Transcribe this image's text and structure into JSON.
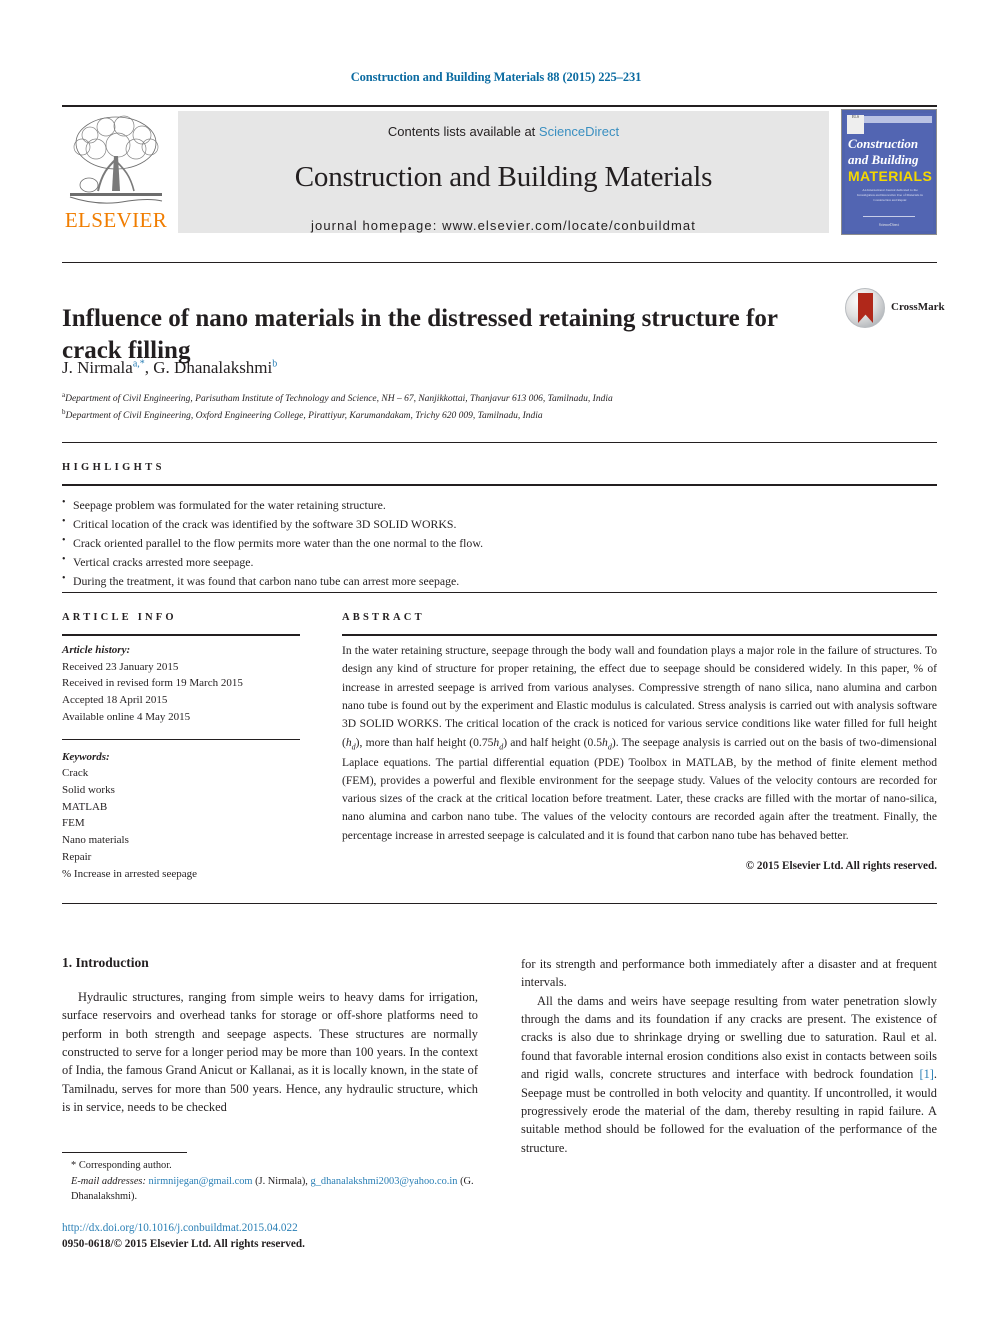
{
  "running_head": "Construction and Building Materials 88 (2015) 225–231",
  "masthead": {
    "publisher_name": "ELSEVIER",
    "contents_prefix": "Contents lists available at ",
    "sciencedirect": "ScienceDirect",
    "journal_title": "Construction and Building Materials",
    "homepage": "journal homepage: www.elsevier.com/locate/conbuildmat",
    "cover": {
      "line1": "Construction",
      "line2": "and Building",
      "line3": "MATERIALS",
      "blurb": "An International Journal dedicated to the Investigation and Innovative Use of Materials in Construction and Repair",
      "footer": "ScienceDirect"
    }
  },
  "article": {
    "title": "Influence of nano materials in the distressed retaining structure for crack filling",
    "crossmark_label": "CrossMark",
    "authors": [
      {
        "name": "J. Nirmala",
        "marks": "a,*"
      },
      {
        "name": "G. Dhanalakshmi",
        "marks": "b"
      }
    ],
    "affiliations": [
      {
        "mark": "a",
        "text": "Department of Civil Engineering, Parisutham Institute of Technology and Science, NH – 67, Nanjikkottai, Thanjavur 613 006, Tamilnadu, India"
      },
      {
        "mark": "b",
        "text": "Department of Civil Engineering, Oxford Engineering College, Pirattiyur, Karumandakam, Trichy 620 009, Tamilnadu, India"
      }
    ]
  },
  "highlights": {
    "heading": "HIGHLIGHTS",
    "items": [
      "Seepage problem was formulated for the water retaining structure.",
      "Critical location of the crack was identified by the software 3D SOLID WORKS.",
      "Crack oriented parallel to the flow permits more water than the one normal to the flow.",
      "Vertical cracks arrested more seepage.",
      "During the treatment, it was found that carbon nano tube can arrest more seepage."
    ]
  },
  "article_info": {
    "heading": "ARTICLE INFO",
    "history_label": "Article history:",
    "history": [
      "Received 23 January 2015",
      "Received in revised form 19 March 2015",
      "Accepted 18 April 2015",
      "Available online 4 May 2015"
    ],
    "keywords_label": "Keywords:",
    "keywords": [
      "Crack",
      "Solid works",
      "MATLAB",
      "FEM",
      "Nano materials",
      "Repair",
      "% Increase in arrested seepage"
    ]
  },
  "abstract": {
    "heading": "ABSTRACT",
    "paragraph_1": "In the water retaining structure, seepage through the body wall and foundation plays a major role in the failure of structures. To design any kind of structure for proper retaining, the effect due to seepage should be considered widely. In this paper, % of increase in arrested seepage is arrived from various analyses. Compressive strength of nano silica, nano alumina and carbon nano tube is found out by the experiment and Elastic modulus is calculated. Stress analysis is carried out with analysis software 3D SOLID WORKS. The critical location of the crack is noticed for various service conditions like water filled for full height (",
    "h_sym": "h",
    "h_sub": "d",
    "paragraph_2": "), more than half height (0.75",
    "paragraph_3": ") and half height (0.5",
    "paragraph_4": "). The seepage analysis is carried out on the basis of two-dimensional Laplace equations. The partial differential equation (PDE) Toolbox in MATLAB, by the method of finite element method (FEM), provides a powerful and flexible environment for the seepage study. Values of the velocity contours are recorded for various sizes of the crack at the critical location before treatment. Later, these cracks are filled with the mortar of nano-silica, nano alumina and carbon nano tube. The values of the velocity contours are recorded again after the treatment. Finally, the percentage increase in arrested seepage is calculated and it is found that carbon nano tube has behaved better.",
    "copyright": "© 2015 Elsevier Ltd. All rights reserved."
  },
  "body": {
    "section_title": "1. Introduction",
    "left_paragraph_1": "Hydraulic structures, ranging from simple weirs to heavy dams for irrigation, surface reservoirs and overhead tanks for storage or off-shore platforms need to perform in both strength and seepage aspects. These structures are normally constructed to serve for a longer period may be more than 100 years. In the context of India, the famous Grand Anicut or Kallanai, as it is locally known, in the state of Tamilnadu, serves for more than 500 years. Hence, any hydraulic structure, which is in service, needs to be checked",
    "right_paragraph_1": "for its strength and performance both immediately after a disaster and at frequent intervals.",
    "right_paragraph_2a": "All the dams and weirs have seepage resulting from water penetration slowly through the dams and its foundation if any cracks are present. The existence of cracks is also due to shrinkage drying or swelling due to saturation. Raul et al. found that favorable internal erosion conditions also exist in contacts between soils and rigid walls, concrete structures and interface with bedrock foundation ",
    "right_ref": "[1]",
    "right_paragraph_2b": ". Seepage must be controlled in both velocity and quantity. If uncontrolled, it would progressively erode the material of the dam, thereby resulting in rapid failure. A suitable method should be followed for the evaluation of the performance of the structure."
  },
  "footnote": {
    "corresponding": "Corresponding author.",
    "email_label": "E-mail addresses:",
    "email_1": "nirmnijegan@gmail.com",
    "email_1_owner": "(J. Nirmala),",
    "email_2": "g_dhanalakshmi2003@yahoo.co.in",
    "email_2_owner": "(G. Dhanalakshmi)."
  },
  "footer": {
    "doi": "http://dx.doi.org/10.1016/j.conbuildmat.2015.04.022",
    "issn": "0950-0618/© 2015 Elsevier Ltd. All rights reserved."
  },
  "colors": {
    "link": "#2a7fb5",
    "elsevier_orange": "#f07d00",
    "cover_blue": "#5265b2",
    "cover_yellow": "#f5d800",
    "masthead_gray": "#e6e6e6"
  }
}
